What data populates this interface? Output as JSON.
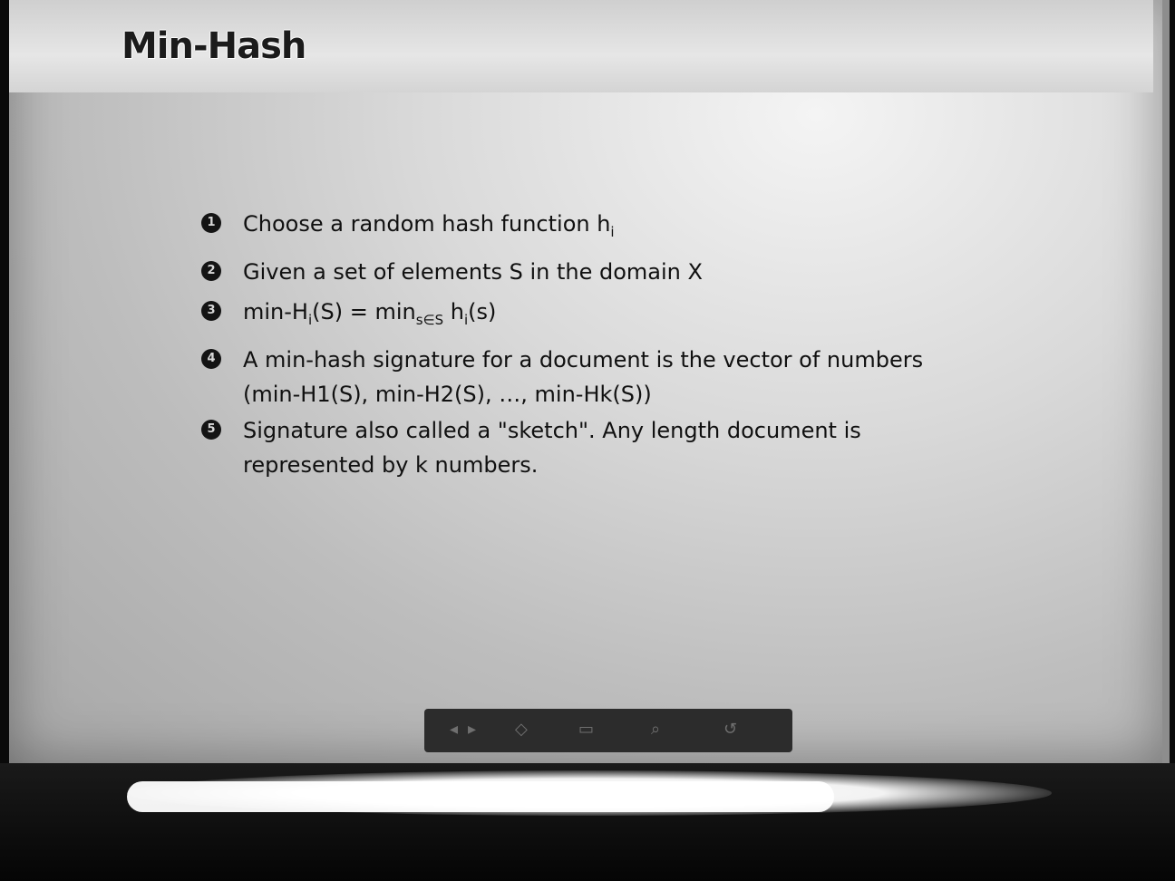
{
  "slide": {
    "title": "Min-Hash",
    "bullets": [
      {
        "num": "1",
        "text": "Choose a random hash function h",
        "sub": "i"
      },
      {
        "num": "2",
        "text": "Given a set of elements S in the domain X"
      },
      {
        "num": "3",
        "text_a": "min-H",
        "sub_a": "i",
        "text_b": "(S) = min",
        "sub_b": "s∈S",
        "text_c": " h",
        "sub_c": "i",
        "text_d": "(s)"
      },
      {
        "num": "4",
        "line1": "A min-hash signature for a document is the vector of numbers",
        "line2": "(min-H1(S), min-H2(S), …, min-Hk(S))"
      },
      {
        "num": "5",
        "line1": "Signature also called a \"sketch\". Any length document is",
        "line2": "represented by k numbers."
      }
    ]
  },
  "nav": {
    "icons": [
      "arrow-left-icon",
      "arrow-right-icon",
      "frame-icon",
      "section-icon",
      "search-icon",
      "undo-icon"
    ]
  }
}
